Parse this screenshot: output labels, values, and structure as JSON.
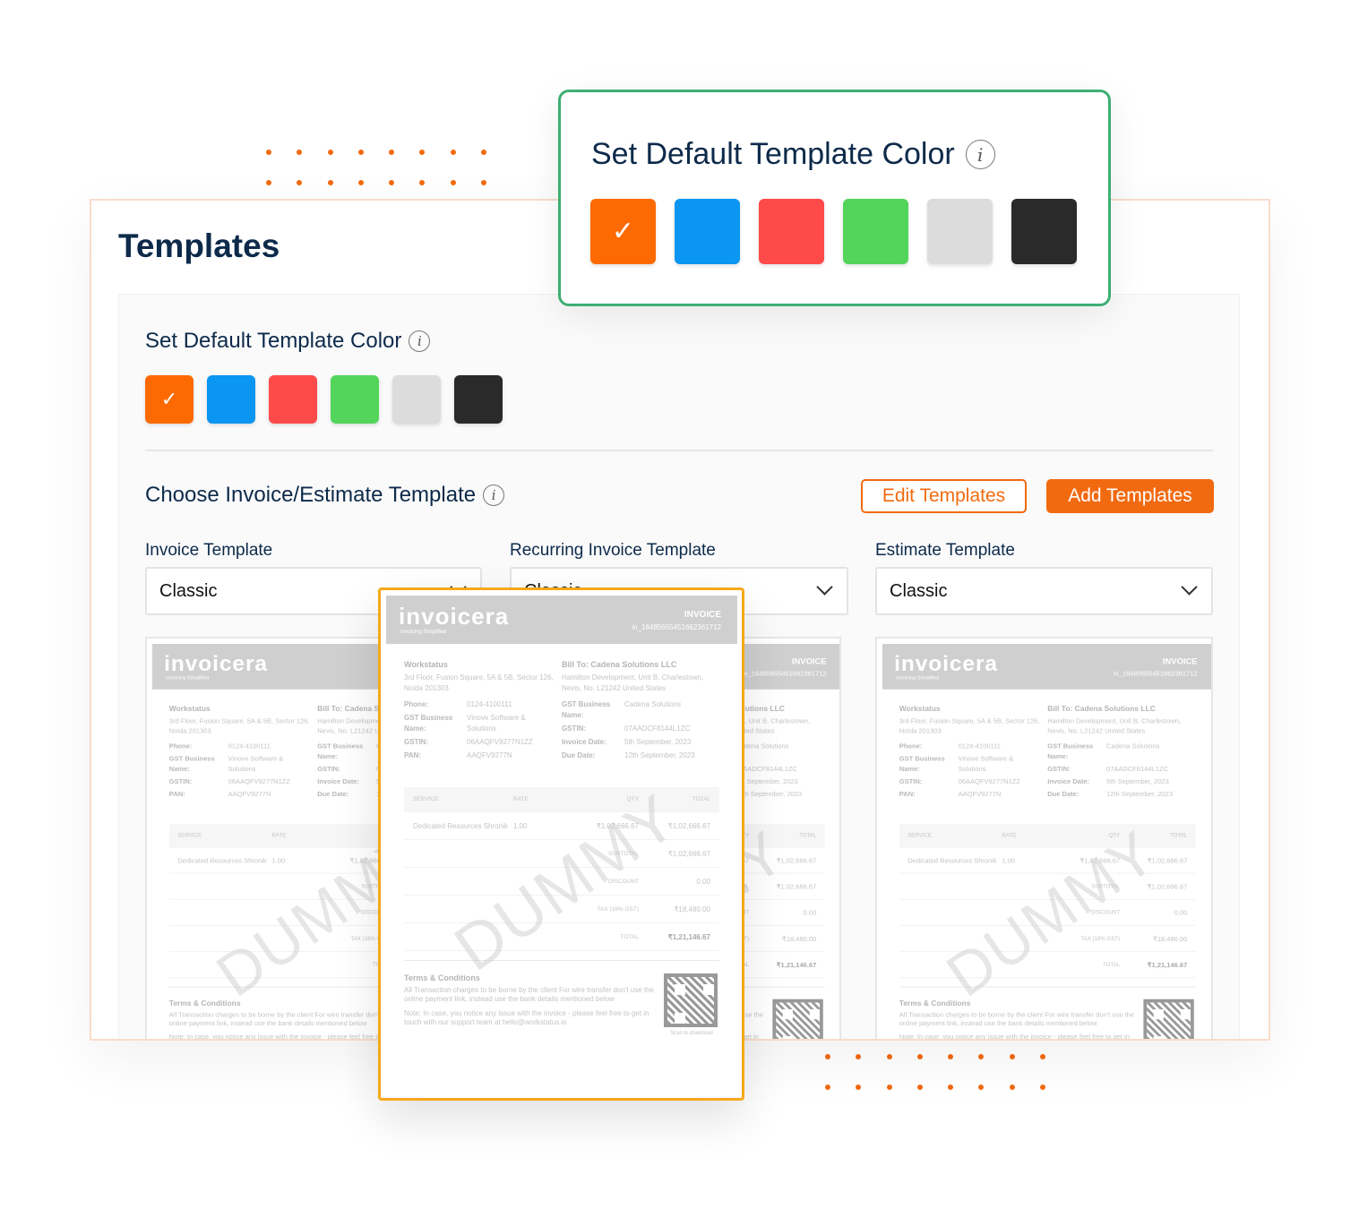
{
  "page_title": "Templates",
  "color_section": {
    "title": "Set Default Template Color",
    "info_icon": "i"
  },
  "colors": [
    {
      "name": "orange",
      "hex": "#FD6A02",
      "selected": true
    },
    {
      "name": "blue",
      "hex": "#0A96F2",
      "selected": false
    },
    {
      "name": "red",
      "hex": "#FF4A4A",
      "selected": false
    },
    {
      "name": "green",
      "hex": "#52D55A",
      "selected": false
    },
    {
      "name": "light-gray",
      "hex": "#DCDCDC",
      "selected": false
    },
    {
      "name": "black",
      "hex": "#2A2A2A",
      "selected": false
    }
  ],
  "check_mark": "✓",
  "template_section": {
    "title": "Choose Invoice/Estimate Template",
    "info_icon": "i",
    "edit_label": "Edit Templates",
    "add_label": "Add Templates"
  },
  "fields": [
    {
      "label": "Invoice Template",
      "value": "Classic"
    },
    {
      "label": "Recurring Invoice Template",
      "value": "Classic"
    },
    {
      "label": "Estimate Template",
      "value": "Classic"
    }
  ],
  "invoice": {
    "logo": "invoicera",
    "tagline": "Invoicing Simplified",
    "type": "INVOICE",
    "number": "in_16485655451662361712",
    "from": {
      "name": "Workstatus",
      "address": "3rd Floor, Fusion Square, 5A & 5B, Sector 126, Noida 201303",
      "rows": [
        [
          "Phone:",
          "0124-4100111"
        ],
        [
          "GST Business Name:",
          "Vinove Software & Solutions"
        ],
        [
          "GSTIN:",
          "06AAQFV9277N1ZZ"
        ],
        [
          "PAN:",
          "AAQFV9277N"
        ]
      ]
    },
    "to": {
      "name": "Bill To: Cadena Solutions LLC",
      "address": "Hamilton Development, Unit B, Charlestown, Nevis, No. L21242 United States",
      "rows": [
        [
          "GST Business Name:",
          "Cadena Solutions"
        ],
        [
          "GSTIN:",
          "07AADCF8144L1ZC"
        ],
        [
          "Invoice Date:",
          "5th September, 2023"
        ],
        [
          "Due Date:",
          "12th September, 2023"
        ]
      ]
    },
    "table_headers": [
      "SERVICE",
      "RATE",
      "QTY",
      "TOTAL"
    ],
    "item": [
      "Dedicated Resources Shronik",
      "1.00",
      "₹1,02,666.67",
      "₹1,02,666.67"
    ],
    "totals": [
      [
        "SUBTOTAL",
        "₹1,02,666.67"
      ],
      [
        "DISCOUNT",
        "0.00"
      ],
      [
        "TAX (18% GST)",
        "₹18,480.00"
      ],
      [
        "TOTAL",
        "₹1,21,146.67"
      ]
    ],
    "terms_title": "Terms & Conditions",
    "terms_text": "All Transaction charges to be borne by the client For wire transfer don't use the online payment link, instead use the bank details mentioned below",
    "note": "Note: In case, you notice any issue with the invoice - please feel free to get in touch with our support team at hello@workstatus.io",
    "qr_caption": "Scan to download",
    "watermark": "DUMMY"
  }
}
